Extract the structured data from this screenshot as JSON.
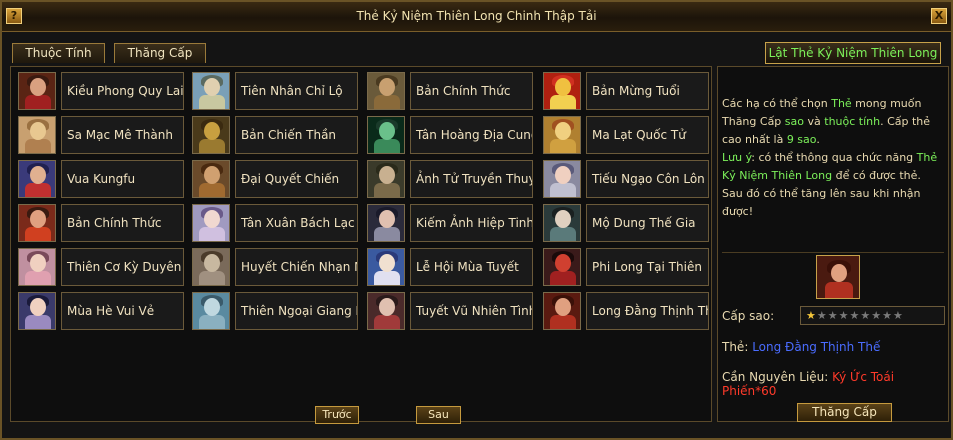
{
  "window": {
    "title": "Thẻ Kỷ Niệm Thiên Long Chinh Thập Tải",
    "help": "?",
    "close": "X"
  },
  "tabs": [
    {
      "label": "Thuộc Tính"
    },
    {
      "label": "Thăng Cấp"
    }
  ],
  "flip_button": "Lật Thẻ Kỷ Niệm Thiên Long",
  "cards": [
    {
      "label": "Kiều Phong Quy Lai",
      "col": 0,
      "row": 0,
      "palette": [
        "#5a2414",
        "#d9a080",
        "#3a1a10",
        "#a02020"
      ]
    },
    {
      "label": "Tiên Nhân Chỉ Lộ",
      "col": 1,
      "row": 0,
      "palette": [
        "#7aa0b8",
        "#e0d0b0",
        "#5a6a60",
        "#c8c8a0"
      ]
    },
    {
      "label": "Bản Chính Thức",
      "col": 2,
      "row": 0,
      "palette": [
        "#6a5a3a",
        "#c8a070",
        "#4a3a20",
        "#8a6a3a"
      ]
    },
    {
      "label": "Bản Mừng Tuổi",
      "col": 3,
      "row": 0,
      "palette": [
        "#b02010",
        "#f0c040",
        "#d03020",
        "#f2d050"
      ]
    },
    {
      "label": "Sa Mạc Mê Thành",
      "col": 0,
      "row": 1,
      "palette": [
        "#c8a070",
        "#e8c890",
        "#9a7040",
        "#b08050"
      ]
    },
    {
      "label": "Bản Chiến Thần",
      "col": 1,
      "row": 1,
      "palette": [
        "#4a3a1a",
        "#c8a040",
        "#3a2a10",
        "#9a7a30"
      ]
    },
    {
      "label": "Tân Hoàng Địa Cung",
      "col": 2,
      "row": 1,
      "palette": [
        "#0a2a1a",
        "#6ac08a",
        "#1a3a2a",
        "#3a8a5a"
      ]
    },
    {
      "label": "Ma Lạt Quốc Tử",
      "col": 3,
      "row": 1,
      "palette": [
        "#b08030",
        "#f0d080",
        "#a05020",
        "#d0a040"
      ]
    },
    {
      "label": "Vua Kungfu",
      "col": 0,
      "row": 2,
      "palette": [
        "#3a3a7a",
        "#e0b090",
        "#202050",
        "#c03030"
      ]
    },
    {
      "label": "Đại Quyết Chiến",
      "col": 1,
      "row": 2,
      "palette": [
        "#6a4a2a",
        "#d0a070",
        "#4a2a10",
        "#a06a30"
      ]
    },
    {
      "label": "Ảnh Tử Truyền Thuy",
      "col": 2,
      "row": 2,
      "palette": [
        "#3a3a2a",
        "#c8b090",
        "#2a2a1a",
        "#7a6a4a"
      ]
    },
    {
      "label": "Tiếu Ngạo Côn Lôn",
      "col": 3,
      "row": 2,
      "palette": [
        "#8a8aa0",
        "#f0d0c0",
        "#5a5a7a",
        "#c0c0d0"
      ]
    },
    {
      "label": "Bản Chính Thức",
      "col": 0,
      "row": 3,
      "palette": [
        "#7a2a1a",
        "#e0a080",
        "#3a1a10",
        "#d04020"
      ]
    },
    {
      "label": "Tân Xuân Bách Lạc Hội",
      "col": 1,
      "row": 3,
      "palette": [
        "#a09ac0",
        "#f0d8d0",
        "#6a5a8a",
        "#d0c0e0"
      ]
    },
    {
      "label": "Kiếm Ảnh Hiệp Tinh",
      "col": 2,
      "row": 3,
      "palette": [
        "#2a2a3a",
        "#e0c0b0",
        "#1a1a2a",
        "#8a8aa0"
      ]
    },
    {
      "label": "Mộ Dung Thế Gia",
      "col": 3,
      "row": 3,
      "palette": [
        "#2a3a3a",
        "#e0d0c0",
        "#1a2020",
        "#5a7a7a"
      ]
    },
    {
      "label": "Thiên Cơ Kỳ Duyên",
      "col": 0,
      "row": 4,
      "palette": [
        "#c090a0",
        "#f0d0c0",
        "#7a4a5a",
        "#e0a0b0"
      ]
    },
    {
      "label": "Huyết Chiến Nhạn Môn",
      "col": 1,
      "row": 4,
      "palette": [
        "#7a6a5a",
        "#c8b8a0",
        "#4a3a2a",
        "#a09080"
      ]
    },
    {
      "label": "Lễ Hội Mùa Tuyết",
      "col": 2,
      "row": 4,
      "palette": [
        "#3a5aa0",
        "#f0e0d0",
        "#2a3a7a",
        "#e0e0f0"
      ]
    },
    {
      "label": "Phi Long Tại Thiên",
      "col": 3,
      "row": 4,
      "palette": [
        "#3a1a1a",
        "#d04030",
        "#1a0a0a",
        "#a02020"
      ]
    },
    {
      "label": "Mùa Hè Vui Vẻ",
      "col": 0,
      "row": 5,
      "palette": [
        "#3a3a6a",
        "#f0d0c0",
        "#1a1a3a",
        "#9a8ac0"
      ]
    },
    {
      "label": "Thiên Ngoại Giang Hồ",
      "col": 1,
      "row": 5,
      "palette": [
        "#5a8aa0",
        "#c0d8e0",
        "#3a5a6a",
        "#8ab0c0"
      ]
    },
    {
      "label": "Tuyết Vũ Nhiên Tình",
      "col": 2,
      "row": 5,
      "palette": [
        "#4a2a2a",
        "#e0c0b0",
        "#2a1a1a",
        "#a03a3a"
      ]
    },
    {
      "label": "Long Đằng Thịnh Thế",
      "col": 3,
      "row": 5,
      "palette": [
        "#5a1a10",
        "#e0a080",
        "#3a1008",
        "#b03020"
      ]
    }
  ],
  "nav": {
    "prev": "Trước",
    "next": "Sau"
  },
  "description": {
    "p1_a": "Các hạ có thể chọn ",
    "p1_b": "Thẻ",
    "p1_c": " mong muốn Thăng Cấp ",
    "p1_d": "sao",
    "p1_e": " và ",
    "p1_f": "thuộc tính",
    "p1_g": ". Cấp thẻ cao nhất là ",
    "p1_h": "9 sao",
    "p1_i": ".",
    "p2_a": "Lưu ý",
    "p2_b": ": có thể thông qua chức năng ",
    "p2_c": "Thẻ Kỷ Niệm Thiên Long",
    "p2_d": " để có được thẻ. Sau đó có thể tăng lên sau khi nhận được!"
  },
  "detail": {
    "star_label": "Cấp sao:",
    "stars_total": 9,
    "stars_filled": 1,
    "card_label": "Thẻ: ",
    "card_value": "Long Đằng Thịnh Thế",
    "material_label": "Cần Nguyên Liệu: ",
    "material_value": "Ký Ức Toái Phiến*60",
    "preview_palette": [
      "#5a1a10",
      "#e0a080",
      "#3a1008",
      "#b03020"
    ]
  },
  "upgrade_button": "Thăng Cấp"
}
